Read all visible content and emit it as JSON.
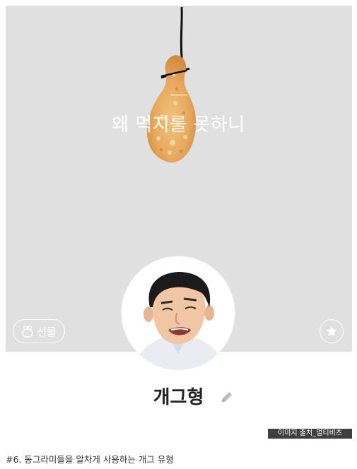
{
  "profile": {
    "status_message": "왜 먹지를 못하니",
    "name": "개그형",
    "gift_label": "선물"
  },
  "icons": {
    "gift": "gift-icon",
    "favorite": "star-icon",
    "edit": "pencil-icon"
  },
  "watermark": "이미지 출처_멀티비츠",
  "caption": "#6. 동그라미들을 알차게 사용하는 개그 유형",
  "colors": {
    "background": "#e0e0e0",
    "text_light": "#ffffff",
    "name_text": "#222222"
  }
}
